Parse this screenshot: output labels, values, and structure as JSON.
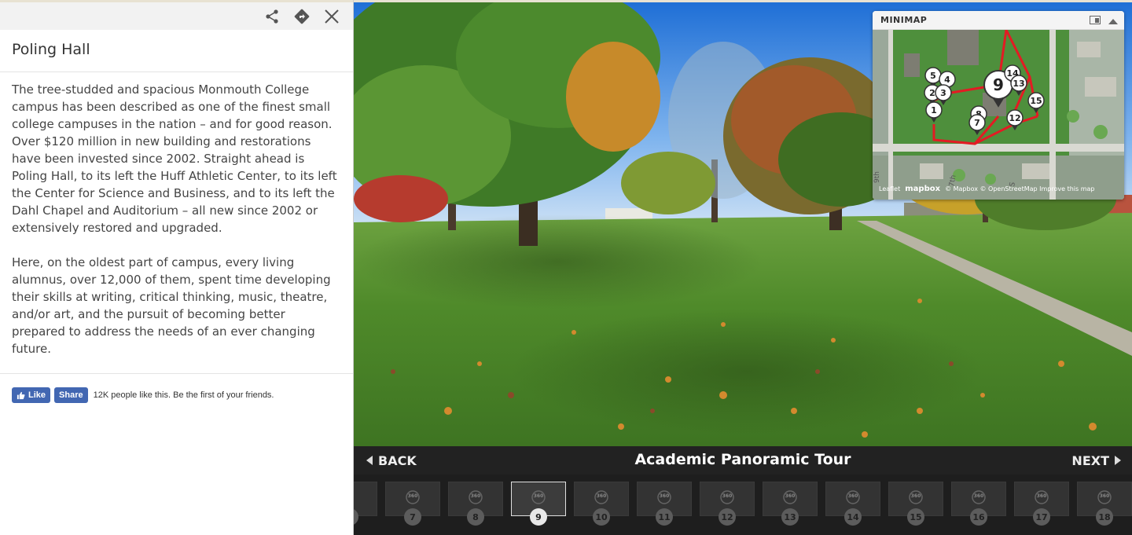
{
  "panel": {
    "title": "Poling Hall",
    "paragraphs": [
      "The tree-studded and spacious Monmouth College campus has been described as one of the finest small college campuses in the nation – and for good reason. Over $120 million in new building and restorations have been invested since 2002. Straight ahead is Poling Hall, to its left the Huff Athletic Center, to its left the Center for Science and Business, and to its left the Dahl Chapel and Auditorium – all new since 2002 or extensively restored and upgraded.",
      "Here, on the oldest part of campus, every living alumnus, over 12,000 of them, spent time developing their skills at writing, critical thinking, music, theatre, and/or art, and the pursuit of becoming better prepared to address the needs of an ever changing future."
    ],
    "facebook": {
      "like_label": "Like",
      "share_label": "Share",
      "social_text": "12K people like this. Be the first of your friends."
    }
  },
  "minimap": {
    "title": "MINIMAP",
    "attribution_leaflet": "Leaflet",
    "attribution_brand": "mapbox",
    "attribution_text": "© Mapbox © OpenStreetMap Improve this map",
    "markers": [
      "5",
      "4",
      "2",
      "3",
      "1",
      "9",
      "14",
      "13",
      "15",
      "8",
      "7",
      "12"
    ],
    "active_marker": "9",
    "street_labels": [
      "9th",
      "7th",
      "S"
    ]
  },
  "tour": {
    "back_label": "BACK",
    "next_label": "NEXT",
    "title": "Academic Panoramic Tour",
    "thumb_icon_text": "360",
    "stops": [
      "7",
      "8",
      "9",
      "10",
      "11",
      "12",
      "13",
      "14",
      "15",
      "16",
      "17",
      "18"
    ],
    "active_stop": "9"
  },
  "colors": {
    "route": "#e31b23",
    "facebook": "#4267b2",
    "bar": "#1e1e1e"
  }
}
